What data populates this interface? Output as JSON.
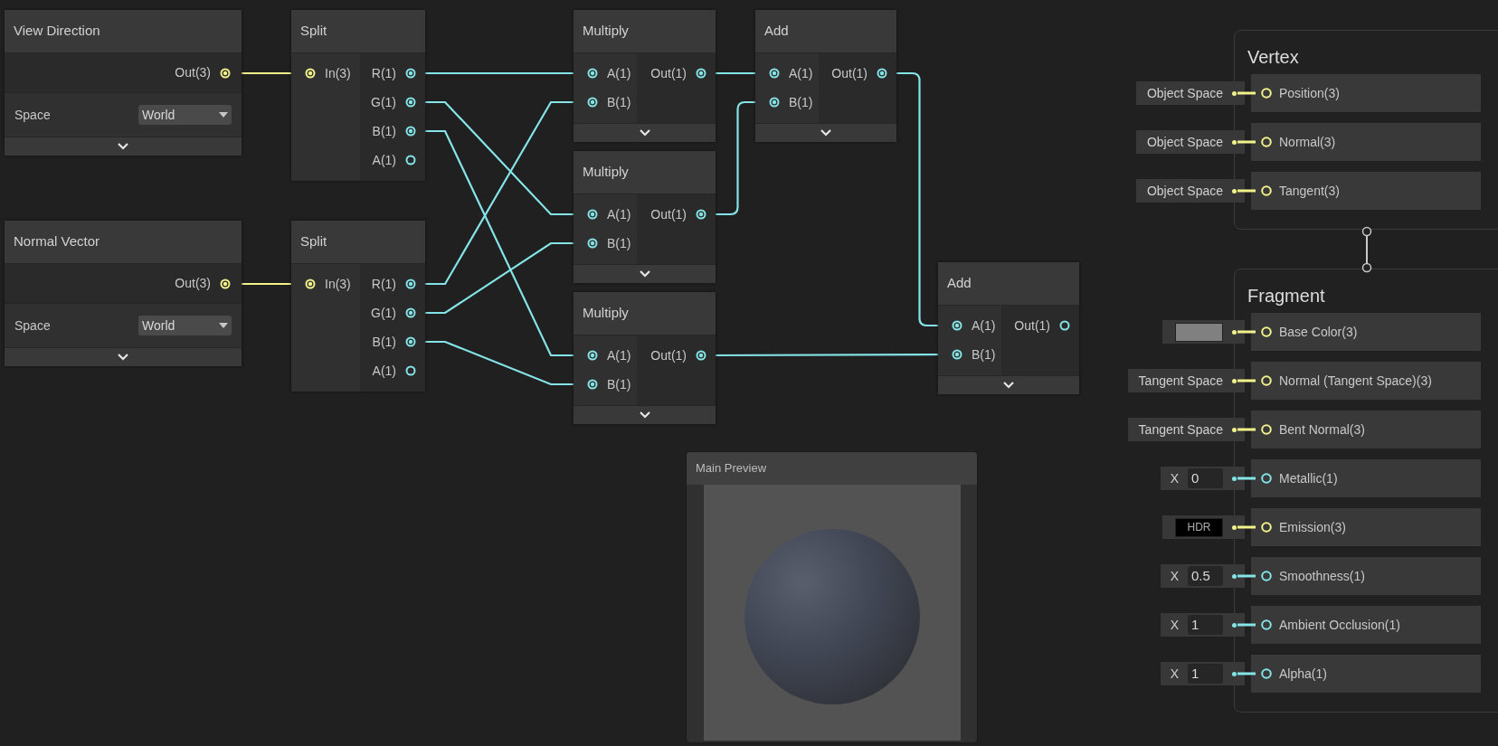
{
  "graph_nodes": [
    {
      "title": "View Direction",
      "kind": "property",
      "outputs": [
        {
          "label": "Out(3)",
          "color": "#f2f28a",
          "connected": true
        }
      ],
      "control": {
        "label": "Space",
        "value": "World"
      },
      "expander": true
    },
    {
      "title": "Normal Vector",
      "kind": "property",
      "outputs": [
        {
          "label": "Out(3)",
          "color": "#f2f28a",
          "connected": true
        }
      ],
      "control": {
        "label": "Space",
        "value": "World"
      },
      "expander": true
    },
    {
      "title": "Split",
      "kind": "operation",
      "inputs": [
        {
          "label": "In(3)",
          "color": "#f2f28a",
          "connected": true
        }
      ],
      "outputs": [
        {
          "label": "R(1)",
          "color": "#84e4e7",
          "connected": true
        },
        {
          "label": "G(1)",
          "color": "#84e4e7",
          "connected": true
        },
        {
          "label": "B(1)",
          "color": "#84e4e7",
          "connected": true
        },
        {
          "label": "A(1)",
          "color": "#84e4e7",
          "connected": false
        }
      ],
      "expander": false
    },
    {
      "title": "Split",
      "kind": "operation",
      "inputs": [
        {
          "label": "In(3)",
          "color": "#f2f28a",
          "connected": true
        }
      ],
      "outputs": [
        {
          "label": "R(1)",
          "color": "#84e4e7",
          "connected": true
        },
        {
          "label": "G(1)",
          "color": "#84e4e7",
          "connected": true
        },
        {
          "label": "B(1)",
          "color": "#84e4e7",
          "connected": true
        },
        {
          "label": "A(1)",
          "color": "#84e4e7",
          "connected": false
        }
      ],
      "expander": false
    },
    {
      "title": "Multiply",
      "kind": "operation",
      "inputs": [
        {
          "label": "A(1)",
          "color": "#84e4e7",
          "connected": true
        },
        {
          "label": "B(1)",
          "color": "#84e4e7",
          "connected": true
        }
      ],
      "outputs": [
        {
          "label": "Out(1)",
          "color": "#84e4e7",
          "connected": true
        }
      ],
      "expander": true
    },
    {
      "title": "Multiply",
      "kind": "operation",
      "inputs": [
        {
          "label": "A(1)",
          "color": "#84e4e7",
          "connected": true
        },
        {
          "label": "B(1)",
          "color": "#84e4e7",
          "connected": true
        }
      ],
      "outputs": [
        {
          "label": "Out(1)",
          "color": "#84e4e7",
          "connected": true
        }
      ],
      "expander": true
    },
    {
      "title": "Multiply",
      "kind": "operation",
      "inputs": [
        {
          "label": "A(1)",
          "color": "#84e4e7",
          "connected": true
        },
        {
          "label": "B(1)",
          "color": "#84e4e7",
          "connected": true
        }
      ],
      "outputs": [
        {
          "label": "Out(1)",
          "color": "#84e4e7",
          "connected": true
        }
      ],
      "expander": true
    },
    {
      "title": "Add",
      "kind": "operation",
      "inputs": [
        {
          "label": "A(1)",
          "color": "#84e4e7",
          "connected": true
        },
        {
          "label": "B(1)",
          "color": "#84e4e7",
          "connected": true
        }
      ],
      "outputs": [
        {
          "label": "Out(1)",
          "color": "#84e4e7",
          "connected": true
        }
      ],
      "expander": true
    },
    {
      "title": "Add",
      "kind": "operation",
      "inputs": [
        {
          "label": "A(1)",
          "color": "#84e4e7",
          "connected": true
        },
        {
          "label": "B(1)",
          "color": "#84e4e7",
          "connected": true
        }
      ],
      "outputs": [
        {
          "label": "Out(1)",
          "color": "#84e4e7",
          "connected": false
        }
      ],
      "expander": true
    }
  ],
  "main_preview": {
    "title": "Main Preview"
  },
  "master_stack": [
    {
      "title": "Vertex",
      "slots": [
        {
          "label": "Position(3)",
          "color": "#f2f28a",
          "input": {
            "kind": "space",
            "text": "Object Space"
          }
        },
        {
          "label": "Normal(3)",
          "color": "#f2f28a",
          "input": {
            "kind": "space",
            "text": "Object Space"
          }
        },
        {
          "label": "Tangent(3)",
          "color": "#f2f28a",
          "input": {
            "kind": "space",
            "text": "Object Space"
          }
        }
      ]
    },
    {
      "title": "Fragment",
      "slots": [
        {
          "label": "Base Color(3)",
          "color": "#f2f28a",
          "input": {
            "kind": "color",
            "color": "#808080"
          }
        },
        {
          "label": "Normal (Tangent Space)(3)",
          "color": "#f2f28a",
          "input": {
            "kind": "space",
            "text": "Tangent Space"
          }
        },
        {
          "label": "Bent Normal(3)",
          "color": "#f2f28a",
          "input": {
            "kind": "space",
            "text": "Tangent Space"
          }
        },
        {
          "label": "Metallic(1)",
          "color": "#84e4e7",
          "input": {
            "kind": "float",
            "axis": "X",
            "value": "0"
          }
        },
        {
          "label": "Emission(3)",
          "color": "#f2f28a",
          "input": {
            "kind": "hdr",
            "text": "HDR"
          }
        },
        {
          "label": "Smoothness(1)",
          "color": "#84e4e7",
          "input": {
            "kind": "float",
            "axis": "X",
            "value": "0.5"
          }
        },
        {
          "label": "Ambient Occlusion(1)",
          "color": "#84e4e7",
          "input": {
            "kind": "float",
            "axis": "X",
            "value": "1"
          }
        },
        {
          "label": "Alpha(1)",
          "color": "#84e4e7",
          "input": {
            "kind": "float",
            "axis": "X",
            "value": "1"
          }
        }
      ]
    }
  ]
}
